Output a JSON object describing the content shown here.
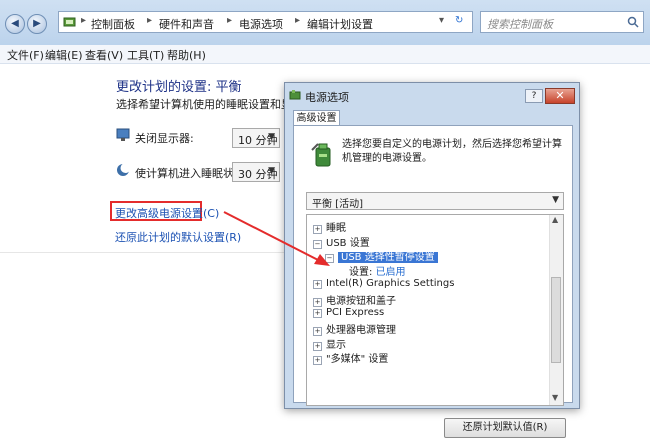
{
  "explorer": {
    "nav_back": "◀",
    "nav_forward": "▶",
    "breadcrumb": [
      "控制面板",
      "硬件和声音",
      "电源选项",
      "编辑计划设置"
    ],
    "search_placeholder": "搜索控制面板",
    "menu": [
      "文件(F)",
      "编辑(E)",
      "查看(V)",
      "工具(T)",
      "帮助(H)"
    ],
    "title": "更改计划的设置: 平衡",
    "subtitle": "选择希望计算机使用的睡眠设置和显示设置",
    "display_off_label": "关闭显示器:",
    "display_off_value": "10 分钟",
    "sleep_label": "使计算机进入睡眠状态:",
    "sleep_value": "30 分钟",
    "advanced_link": "更改高级电源设置(C)",
    "restore_link": "还原此计划的默认设置(R)"
  },
  "dialog": {
    "title": "电源选项",
    "help": "?",
    "close": "✕",
    "tab": "高级设置",
    "description": "选择您要自定义的电源计划，然后选择您希望计算机管理的电源设置。",
    "plan_value": "平衡 [活动]",
    "tree": [
      {
        "label": "睡眠",
        "expander": "+",
        "indent": 0
      },
      {
        "label": "USB 设置",
        "expander": "−",
        "indent": 0
      },
      {
        "label": "USB 选择性暂停设置",
        "expander": "−",
        "indent": 1,
        "selected": true
      },
      {
        "label": "设置:",
        "value": "已启用",
        "indent": 2
      },
      {
        "label": "Intel(R) Graphics Settings",
        "expander": "+",
        "indent": 0
      },
      {
        "label": "电源按钮和盖子",
        "expander": "+",
        "indent": 0
      },
      {
        "label": "PCI Express",
        "expander": "+",
        "indent": 0
      },
      {
        "label": "处理器电源管理",
        "expander": "+",
        "indent": 0
      },
      {
        "label": "显示",
        "expander": "+",
        "indent": 0
      },
      {
        "label": "\"多媒体\" 设置",
        "expander": "+",
        "indent": 0
      }
    ],
    "restore_button": "还原计划默认值(R)"
  },
  "colors": {
    "highlight_box": "#e42c2c",
    "arrow": "#e42c2c",
    "selection": "#3a76d4",
    "link": "#1c52b3"
  }
}
